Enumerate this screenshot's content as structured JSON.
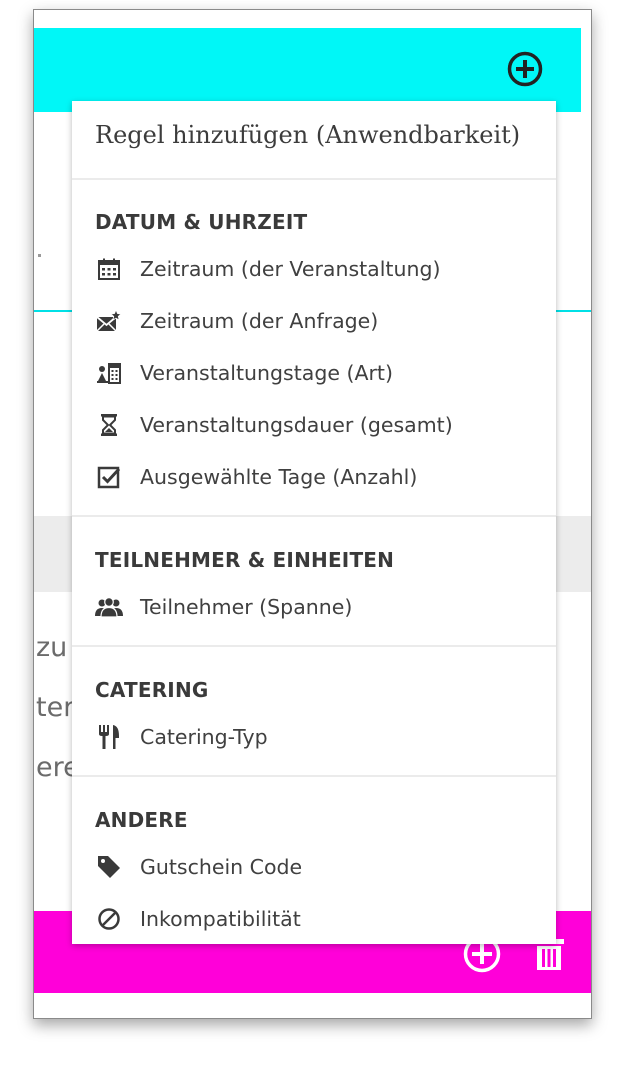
{
  "background": {
    "partial_texts": [
      "zu",
      "ter",
      "ere"
    ]
  },
  "menu": {
    "title": "Regel hinzufügen (Anwendbarkeit)",
    "sections": [
      {
        "header": "DATUM & UHRZEIT",
        "items": [
          {
            "label": "Zeitraum (der Veranstaltung)",
            "icon": "calendar-icon"
          },
          {
            "label": "Zeitraum (der Anfrage)",
            "icon": "envelope-star-icon"
          },
          {
            "label": "Veranstaltungstage (Art)",
            "icon": "calendar-type-icon"
          },
          {
            "label": "Veranstaltungsdauer (gesamt)",
            "icon": "hourglass-icon"
          },
          {
            "label": "Ausgewählte Tage (Anzahl)",
            "icon": "checkbox-icon"
          }
        ]
      },
      {
        "header": "TEILNEHMER & EINHEITEN",
        "items": [
          {
            "label": "Teilnehmer (Spanne)",
            "icon": "people-group-icon"
          }
        ]
      },
      {
        "header": "CATERING",
        "items": [
          {
            "label": "Catering-Typ",
            "icon": "fork-knife-icon"
          }
        ]
      },
      {
        "header": "ANDERE",
        "items": [
          {
            "label": "Gutschein Code",
            "icon": "tag-icon"
          },
          {
            "label": "Inkompatibilität",
            "icon": "forbidden-icon"
          }
        ]
      }
    ]
  },
  "colors": {
    "cyan_bar": "#00f7f7",
    "magenta_bar": "#ff00d9",
    "menu_text": "#404040",
    "section_header": "#3a3a3a"
  }
}
